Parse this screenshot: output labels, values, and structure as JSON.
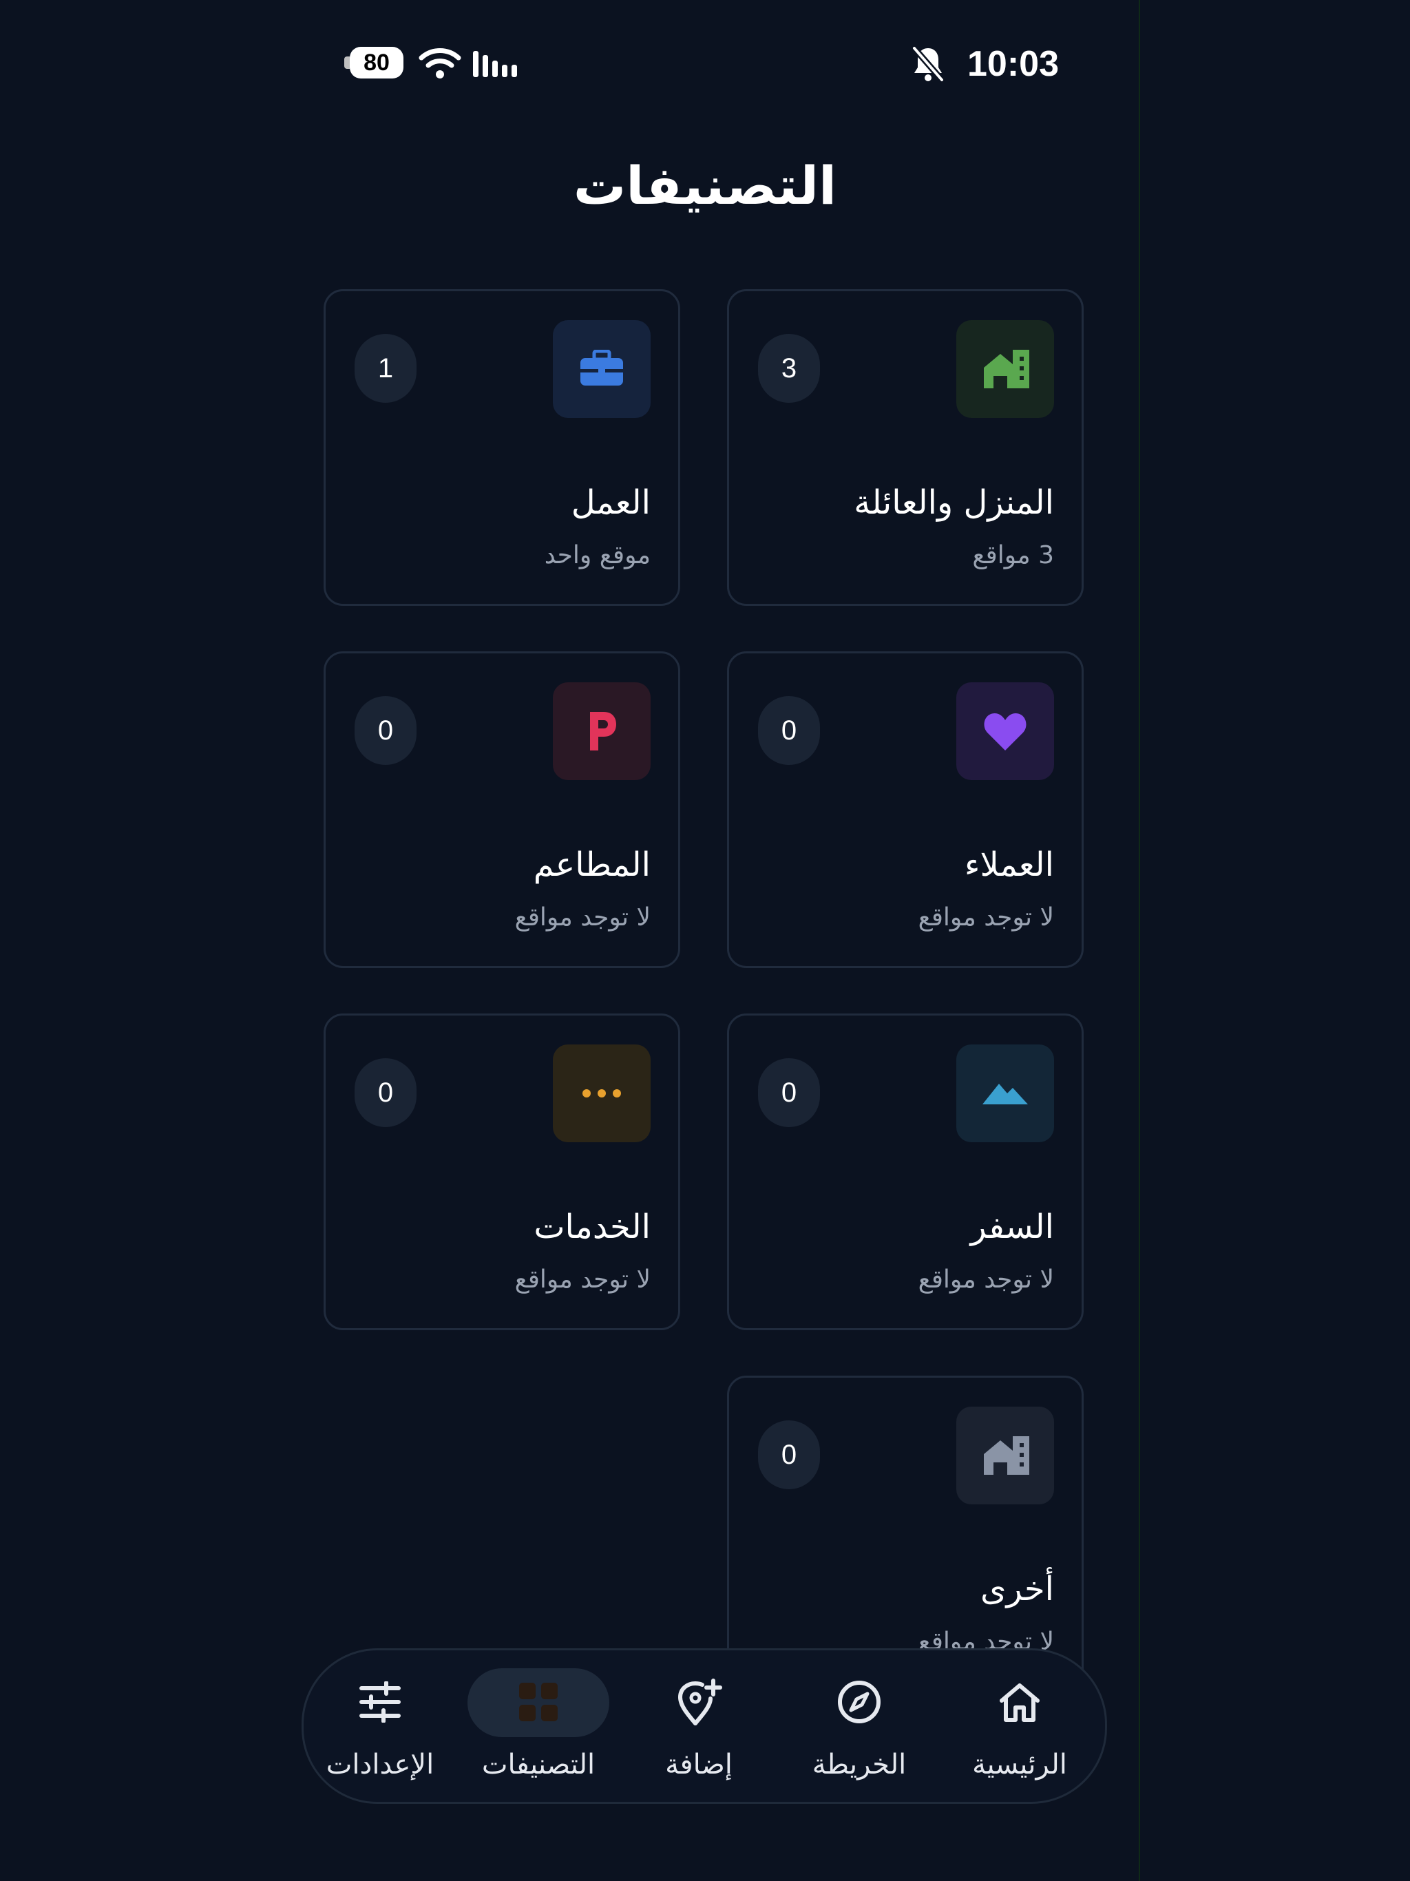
{
  "status_bar": {
    "time": "10:03",
    "battery": "80",
    "icons": [
      "bell-slash-icon",
      "wifi-icon",
      "signal-icon",
      "battery-icon"
    ]
  },
  "header": {
    "title": "التصنيفات"
  },
  "categories": [
    {
      "name": "المنزل والعائلة",
      "subtitle": "3 مواقع",
      "count": "3",
      "icon": "home-icon",
      "icon_color": "#5aa84f",
      "icon_bg": "#17261f"
    },
    {
      "name": "العمل",
      "subtitle": "موقع واحد",
      "count": "1",
      "icon": "briefcase-icon",
      "icon_color": "#3b7be0",
      "icon_bg": "#15233d"
    },
    {
      "name": "العملاء",
      "subtitle": "لا توجد مواقع",
      "count": "0",
      "icon": "heart-icon",
      "icon_color": "#8a4cf0",
      "icon_bg": "#211a3e"
    },
    {
      "name": "المطاعم",
      "subtitle": "لا توجد مواقع",
      "count": "0",
      "icon": "parking-icon",
      "icon_color": "#e2345a",
      "icon_bg": "#2a1825"
    },
    {
      "name": "السفر",
      "subtitle": "لا توجد مواقع",
      "count": "0",
      "icon": "mountain-icon",
      "icon_color": "#3aa0cf",
      "icon_bg": "#132637"
    },
    {
      "name": "الخدمات",
      "subtitle": "لا توجد مواقع",
      "count": "0",
      "icon": "more-dots-icon",
      "icon_color": "#e8a12e",
      "icon_bg": "#2b2517"
    },
    {
      "name": "أخرى",
      "subtitle": "لا توجد مواقع",
      "count": "0",
      "icon": "home-icon",
      "icon_color": "#8a94a6",
      "icon_bg": "#1b2230"
    }
  ],
  "bottom_nav": [
    {
      "label": "الرئيسية",
      "icon": "home-outline-icon",
      "active": false
    },
    {
      "label": "الخريطة",
      "icon": "compass-icon",
      "active": false
    },
    {
      "label": "إضافة",
      "icon": "add-location-icon",
      "active": false
    },
    {
      "label": "التصنيفات",
      "icon": "grid-icon",
      "active": true,
      "active_color": "#2a1c12"
    },
    {
      "label": "الإعدادات",
      "icon": "sliders-icon",
      "active": false
    }
  ]
}
